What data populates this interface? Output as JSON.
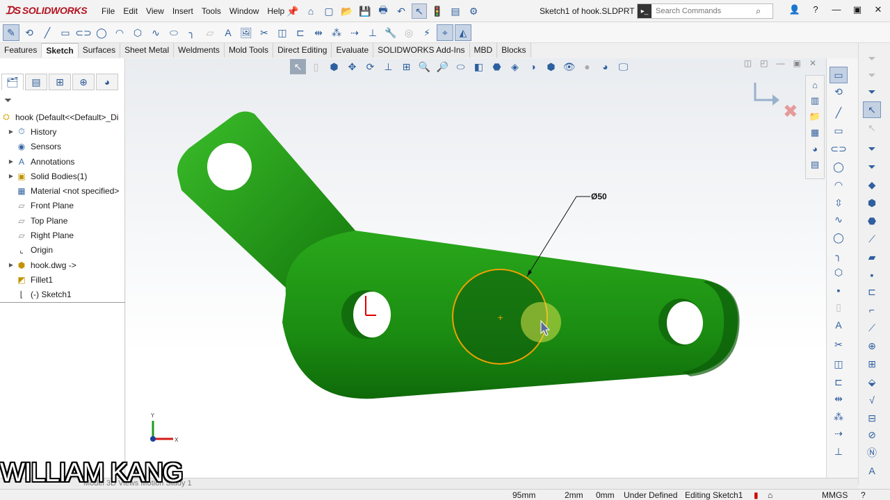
{
  "app": {
    "logo": "SOLIDWORKS",
    "document_title": "Sketch1 of hook.SLDPRT *",
    "search_placeholder": "Search Commands"
  },
  "menu": [
    "File",
    "Edit",
    "View",
    "Insert",
    "Tools",
    "Window",
    "Help"
  ],
  "tabs": [
    {
      "label": "Features",
      "active": false
    },
    {
      "label": "Sketch",
      "active": true
    },
    {
      "label": "Surfaces",
      "active": false
    },
    {
      "label": "Sheet Metal",
      "active": false
    },
    {
      "label": "Weldments",
      "active": false
    },
    {
      "label": "Mold Tools",
      "active": false
    },
    {
      "label": "Direct Editing",
      "active": false
    },
    {
      "label": "Evaluate",
      "active": false
    },
    {
      "label": "SOLIDWORKS Add-Ins",
      "active": false
    },
    {
      "label": "MBD",
      "active": false
    },
    {
      "label": "Blocks",
      "active": false
    }
  ],
  "feature_tree": {
    "root": "hook  (Default<<Default>_Di",
    "items": [
      {
        "label": "History",
        "icon": "history-icon",
        "expandable": true
      },
      {
        "label": "Sensors",
        "icon": "sensors-icon",
        "expandable": false
      },
      {
        "label": "Annotations",
        "icon": "annotations-icon",
        "expandable": true
      },
      {
        "label": "Solid Bodies(1)",
        "icon": "solid-bodies-icon",
        "expandable": true
      },
      {
        "label": "Material <not specified>",
        "icon": "material-icon",
        "expandable": false
      },
      {
        "label": "Front Plane",
        "icon": "plane-icon",
        "expandable": false
      },
      {
        "label": "Top Plane",
        "icon": "plane-icon",
        "expandable": false
      },
      {
        "label": "Right Plane",
        "icon": "plane-icon",
        "expandable": false
      },
      {
        "label": "Origin",
        "icon": "origin-icon",
        "expandable": false
      },
      {
        "label": "hook.dwg ->",
        "icon": "dwg-feature-icon",
        "expandable": true
      },
      {
        "label": "Fillet1",
        "icon": "fillet-icon",
        "expandable": false
      },
      {
        "label": "(-) Sketch1",
        "icon": "sketch-icon",
        "expandable": false
      }
    ]
  },
  "viewport": {
    "dimension_label": "Ø50",
    "triad_x": "X",
    "triad_y": "Y",
    "part_color": "#1e8a14",
    "sketch_color": "#f0a000"
  },
  "bottom_tab": "Model   3D Views   Motion Study 1",
  "status": {
    "x": "95mm",
    "y": "2mm",
    "z": "0mm",
    "state": "Under Defined",
    "mode": "Editing Sketch1",
    "units": "MMGS"
  },
  "watermark": "WILLIAM KANG"
}
